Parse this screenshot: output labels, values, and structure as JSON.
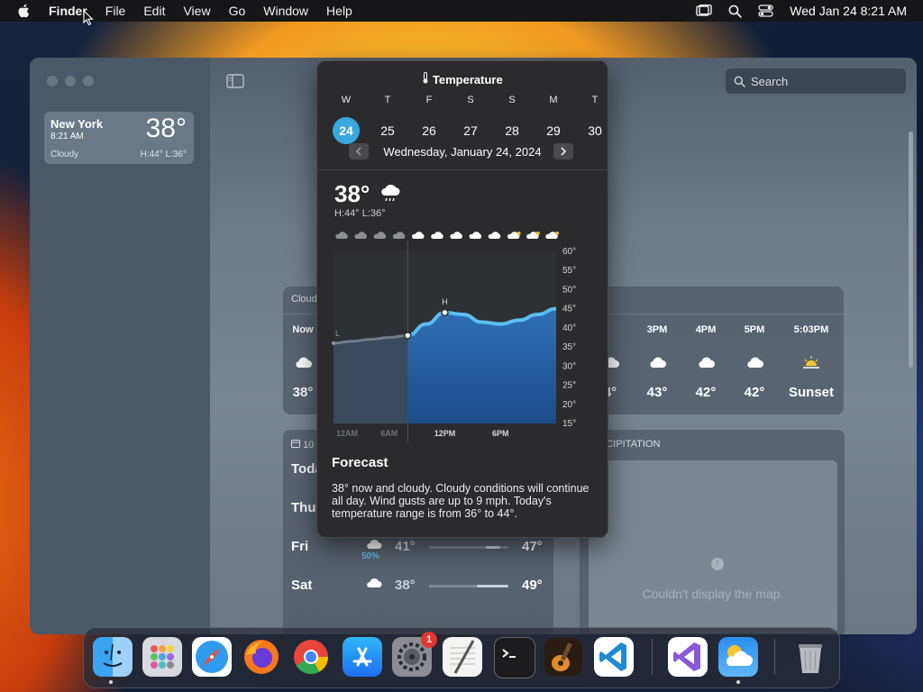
{
  "menubar": {
    "app": "Finder",
    "items": [
      "File",
      "Edit",
      "View",
      "Go",
      "Window",
      "Help"
    ],
    "clock": "Wed Jan 24  8:21 AM"
  },
  "sidebar": {
    "location": {
      "city": "New York",
      "time": "8:21 AM",
      "temp": "38°",
      "condition": "Cloudy",
      "hilo": "H:44°  L:36°"
    }
  },
  "search": {
    "placeholder": "Search"
  },
  "hourly": {
    "header": "Cloud",
    "now_label": "Now",
    "now_temp": "38°",
    "items": [
      {
        "label": "3PM",
        "temp": "43°",
        "icon": "cloud-icon"
      },
      {
        "label": "4PM",
        "temp": "42°",
        "icon": "cloud-icon"
      },
      {
        "label": "5PM",
        "temp": "42°",
        "icon": "cloud-icon"
      },
      {
        "label": "5:03PM",
        "temp": "Sunset",
        "icon": "sunset-icon"
      }
    ],
    "partial_temp": "4°"
  },
  "daily": {
    "header": "10",
    "rows": [
      {
        "day": "Toda",
        "lo": "",
        "hi": "",
        "pct": ""
      },
      {
        "day": "Thu",
        "lo": "",
        "hi": "",
        "pct": ""
      },
      {
        "day": "Fri",
        "lo": "41°",
        "hi": "47°",
        "pct": "50%",
        "fill_start": 0.72,
        "fill_end": 0.9
      },
      {
        "day": "Sat",
        "lo": "38°",
        "hi": "49°",
        "pct": "",
        "fill_start": 0.6,
        "fill_end": 1.0
      }
    ]
  },
  "precip": {
    "header": "ECIPITATION",
    "message": "Couldn't display the map."
  },
  "popover": {
    "title": "Temperature",
    "weekdays": [
      "W",
      "T",
      "F",
      "S",
      "S",
      "M",
      "T"
    ],
    "dates": [
      "24",
      "25",
      "26",
      "27",
      "28",
      "29",
      "30"
    ],
    "selected_index": 0,
    "date_label": "Wednesday, January 24, 2024",
    "current_temp": "38°",
    "hilo": "H:44°  L:36°",
    "high_marker": "H",
    "low_marker": "L",
    "forecast_title": "Forecast",
    "forecast_text": "38° now and cloudy. Cloudy conditions will continue all day. Wind gusts are up to 9 mph. Today's temperature range is from 36° to 44°."
  },
  "chart_data": {
    "type": "area",
    "x": [
      "12AM",
      "2AM",
      "4AM",
      "6AM",
      "8AM",
      "10AM",
      "12PM",
      "2PM",
      "4PM",
      "6PM",
      "8PM",
      "10PM",
      "12AM"
    ],
    "values": [
      36,
      36.5,
      37,
      37.5,
      38,
      41,
      44,
      43.5,
      41.5,
      41,
      42,
      43.5,
      45
    ],
    "xticks": [
      "12AM",
      "6AM",
      "12PM",
      "6PM"
    ],
    "yticks": [
      "60°",
      "55°",
      "50°",
      "45°",
      "40°",
      "35°",
      "30°",
      "25°",
      "20°",
      "15°"
    ],
    "ylim": [
      15,
      60
    ],
    "current_index": 4,
    "high_index": 6,
    "low_index": 0,
    "hour_icons": [
      "cloud",
      "cloud",
      "cloud",
      "cloud",
      "cloud",
      "cloud",
      "cloud",
      "cloud",
      "cloud",
      "cloud-sun",
      "cloud-sun",
      "cloud-sun"
    ],
    "colors": {
      "line": "#5cbef0",
      "fill_top": "#2f6fb5",
      "fill_bottom": "#1c4c8a",
      "past_fill": "#3a4a5e"
    }
  },
  "dock": {
    "apps": [
      "finder-icon",
      "launchpad-icon",
      "safari-icon",
      "firefox-icon",
      "chrome-icon",
      "app-store-icon",
      "system-settings-icon",
      "textedit-icon",
      "terminal-icon",
      "garageband-icon",
      "vscode-icon",
      "visual-studio-icon",
      "weather-icon",
      "trash-icon"
    ],
    "settings_badge": "1"
  }
}
